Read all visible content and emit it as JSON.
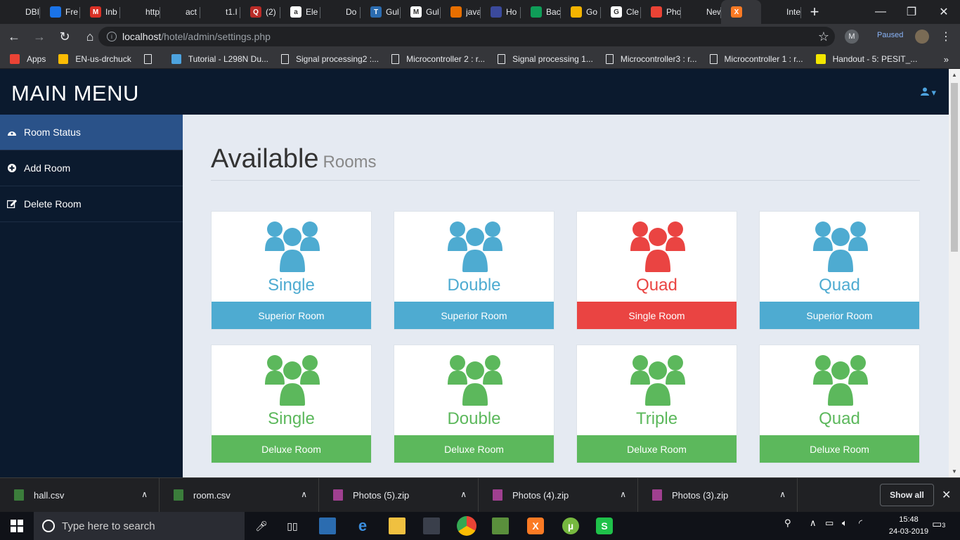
{
  "browser": {
    "tabs": [
      {
        "title": "DBI",
        "icon_color": "#202124",
        "icon_text": ""
      },
      {
        "title": "Fre",
        "icon_color": "#1a73e8",
        "icon_text": ""
      },
      {
        "title": "Inb",
        "icon_color": "#d93025",
        "icon_text": "M"
      },
      {
        "title": "http",
        "icon_color": "#202124",
        "icon_text": ""
      },
      {
        "title": "act",
        "icon_color": "#202124",
        "icon_text": ""
      },
      {
        "title": "t1.I",
        "icon_color": "#202124",
        "icon_text": ""
      },
      {
        "title": "(2)",
        "icon_color": "#b92b27",
        "icon_text": "Q"
      },
      {
        "title": "Ele",
        "icon_color": "#ffffff",
        "icon_text": "a"
      },
      {
        "title": "Do",
        "icon_color": "#202124",
        "icon_text": ""
      },
      {
        "title": "Gul",
        "icon_color": "#2b6cb0",
        "icon_text": "T"
      },
      {
        "title": "Gul",
        "icon_color": "#ffffff",
        "icon_text": "M"
      },
      {
        "title": "java",
        "icon_color": "#e76f00",
        "icon_text": ""
      },
      {
        "title": "Ho",
        "icon_color": "#3b4a9c",
        "icon_text": ""
      },
      {
        "title": "Bac",
        "icon_color": "#0f9d58",
        "icon_text": ""
      },
      {
        "title": "Go",
        "icon_color": "#f4b400",
        "icon_text": ""
      },
      {
        "title": "Cle",
        "icon_color": "#ffffff",
        "icon_text": "G"
      },
      {
        "title": "Pho",
        "icon_color": "#ea4335",
        "icon_text": ""
      },
      {
        "title": "New Ta",
        "icon_color": "#202124",
        "icon_text": ""
      },
      {
        "title": "",
        "icon_color": "#fb7a24",
        "icon_text": "X",
        "active": true
      },
      {
        "title": "Inte",
        "icon_color": "#202124",
        "icon_text": ""
      }
    ],
    "new_tab": "+",
    "window_controls": {
      "minimize": "—",
      "maximize": "❐",
      "close": "✕"
    },
    "nav": {
      "back": "←",
      "forward": "→",
      "reload": "↻",
      "home": "⌂"
    },
    "url_host": "localhost",
    "url_path": "/hotel/admin/settings.php",
    "profile_initial": "M",
    "paused_label": "Paused",
    "menu_icon": "⋮",
    "bookmarks": [
      {
        "label": "Apps",
        "icon": "apps-icon",
        "color": "#ea4335"
      },
      {
        "label": "EN-us-drchuck",
        "icon": "drive-icon",
        "color": "#fbbc04"
      },
      {
        "label": "",
        "icon": "doc-icon",
        "color": "#e8eaed"
      },
      {
        "label": "Tutorial - L298N Du...",
        "icon": "site-icon",
        "color": "#4da3df"
      },
      {
        "label": "Signal processing2 :...",
        "icon": "doc-icon",
        "color": "#e8eaed"
      },
      {
        "label": "Microcontroller 2 : r...",
        "icon": "doc-icon",
        "color": "#e8eaed"
      },
      {
        "label": "Signal processing 1...",
        "icon": "doc-icon",
        "color": "#e8eaed"
      },
      {
        "label": "Microcontroller3 : r...",
        "icon": "doc-icon",
        "color": "#e8eaed"
      },
      {
        "label": "Microcontroller 1 : r...",
        "icon": "doc-icon",
        "color": "#e8eaed"
      },
      {
        "label": "Handout - 5: PESIT_...",
        "icon": "handout-icon",
        "color": "#f2e600"
      }
    ],
    "bookmarks_more": "»"
  },
  "app": {
    "brand": "MAIN MENU",
    "user_menu": "▾",
    "sidebar": [
      {
        "label": "Room Status",
        "icon": "dashboard-icon",
        "active": true
      },
      {
        "label": "Add Room",
        "icon": "plus-circle-icon",
        "active": false
      },
      {
        "label": "Delete Room",
        "icon": "edit-icon",
        "active": false
      }
    ],
    "heading": "Available",
    "heading_sub": "Rooms",
    "rooms": [
      {
        "bed": "Single",
        "type": "Superior Room",
        "color": "#4eabd1"
      },
      {
        "bed": "Double",
        "type": "Superior Room",
        "color": "#4eabd1"
      },
      {
        "bed": "Quad",
        "type": "Single Room",
        "color": "#ea4442"
      },
      {
        "bed": "Quad",
        "type": "Superior Room",
        "color": "#4eabd1"
      },
      {
        "bed": "Single",
        "type": "Deluxe Room",
        "color": "#5cb85c"
      },
      {
        "bed": "Double",
        "type": "Deluxe Room",
        "color": "#5cb85c"
      },
      {
        "bed": "Triple",
        "type": "Deluxe Room",
        "color": "#5cb85c"
      },
      {
        "bed": "Quad",
        "type": "Deluxe Room",
        "color": "#5cb85c"
      }
    ]
  },
  "downloads": {
    "items": [
      {
        "name": "hall.csv",
        "icon_color": "#3b7d3b"
      },
      {
        "name": "room.csv",
        "icon_color": "#3b7d3b"
      },
      {
        "name": "Photos (5).zip",
        "icon_color": "#a04090"
      },
      {
        "name": "Photos (4).zip",
        "icon_color": "#a04090"
      },
      {
        "name": "Photos (3).zip",
        "icon_color": "#a04090"
      }
    ],
    "chevron": "∧",
    "show_all": "Show all",
    "close": "✕"
  },
  "taskbar": {
    "search_placeholder": "Type here to search",
    "time": "15:48",
    "date": "24-03-2019",
    "notification_count": "3"
  }
}
